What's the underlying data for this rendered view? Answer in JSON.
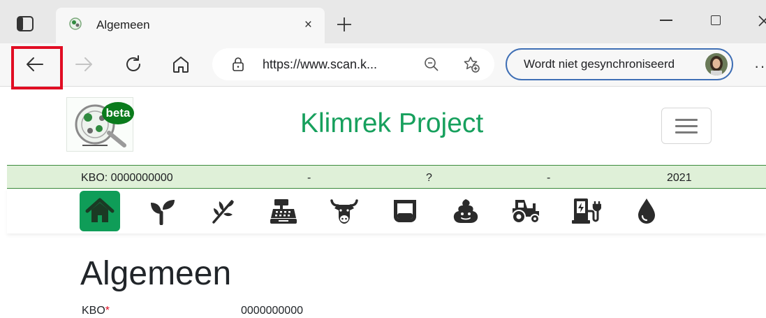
{
  "browser": {
    "tab": {
      "title": "Algemeen",
      "close": "×"
    },
    "address": {
      "url": "https://www.scan.k..."
    },
    "profile": {
      "label": "Wordt niet gesynchroniseerd"
    },
    "more": "···"
  },
  "site": {
    "logo_badge": "beta",
    "title": "Klimrek Project",
    "kbo_bar": [
      "KBO: 0000000000",
      "-",
      "?",
      "-",
      "2021"
    ]
  },
  "nav_icons": [
    "home-icon",
    "seedling-icon",
    "plant-icon",
    "cash-register-icon",
    "cow-icon",
    "tank-icon",
    "manure-icon",
    "tractor-icon",
    "charging-station-icon",
    "water-drop-icon"
  ],
  "page": {
    "heading": "Algemeen",
    "fields": [
      {
        "label": "KBO",
        "required_mark": "*",
        "value": "0000000000"
      }
    ]
  },
  "colors": {
    "accent_green": "#17a05d",
    "active_nav": "#0f9d58",
    "kbo_bar_bg": "#dff0d8",
    "highlight_red": "#e10d23",
    "profile_border": "#3f6fb5"
  }
}
